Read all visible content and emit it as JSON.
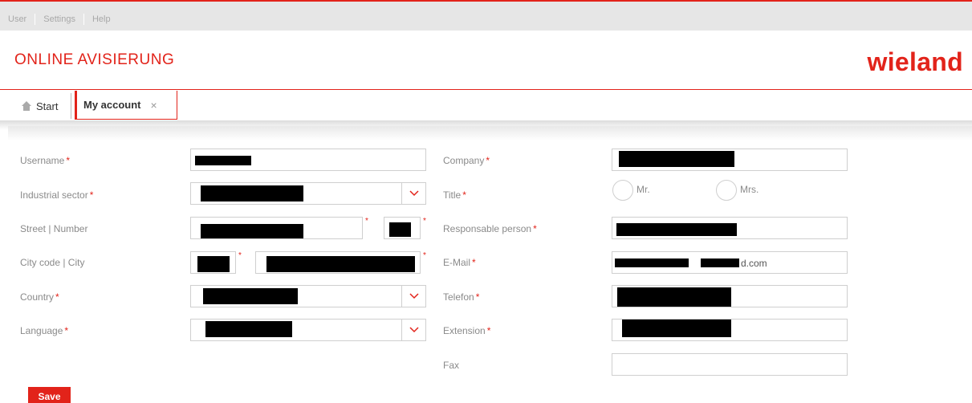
{
  "topmenu": {
    "items": [
      "User",
      "Settings",
      "Help"
    ]
  },
  "app": {
    "title": "ONLINE AVISIERUNG",
    "logo": "wieland"
  },
  "tabs": {
    "start": "Start",
    "account": "My account",
    "close": "×"
  },
  "form": {
    "username": "Username",
    "industrial_sector": "Industrial sector",
    "street_number": "Street | Number",
    "city_code_city": "City code | City",
    "country": "Country",
    "language": "Language",
    "company": "Company",
    "title": "Title",
    "title_options": [
      "Mr.",
      "Mrs."
    ],
    "responsible_person": "Responsable person",
    "email": "E-Mail",
    "email_value_visible": "d.com",
    "telefon": "Telefon",
    "extension": "Extension",
    "fax": "Fax",
    "required_marker": "*"
  },
  "actions": {
    "save": "Save"
  },
  "colors": {
    "accent": "#e2231a"
  }
}
